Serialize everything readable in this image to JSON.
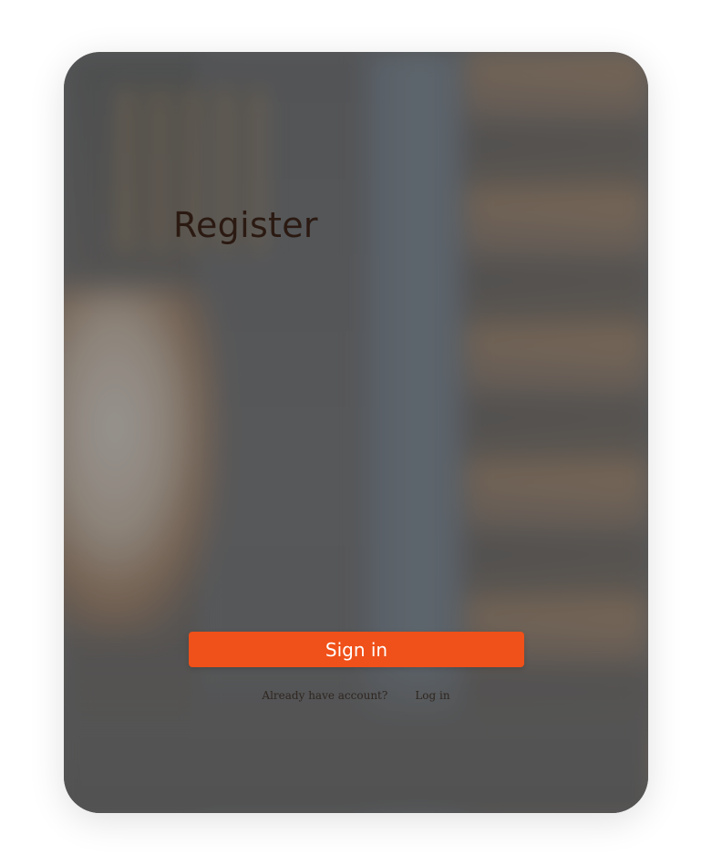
{
  "form": {
    "title": "Register",
    "submit_label": "Sign in"
  },
  "footer": {
    "prompt": "Already have account?",
    "login_link": "Log in"
  },
  "colors": {
    "accent": "#f05019",
    "title_text": "#2b1a12"
  }
}
